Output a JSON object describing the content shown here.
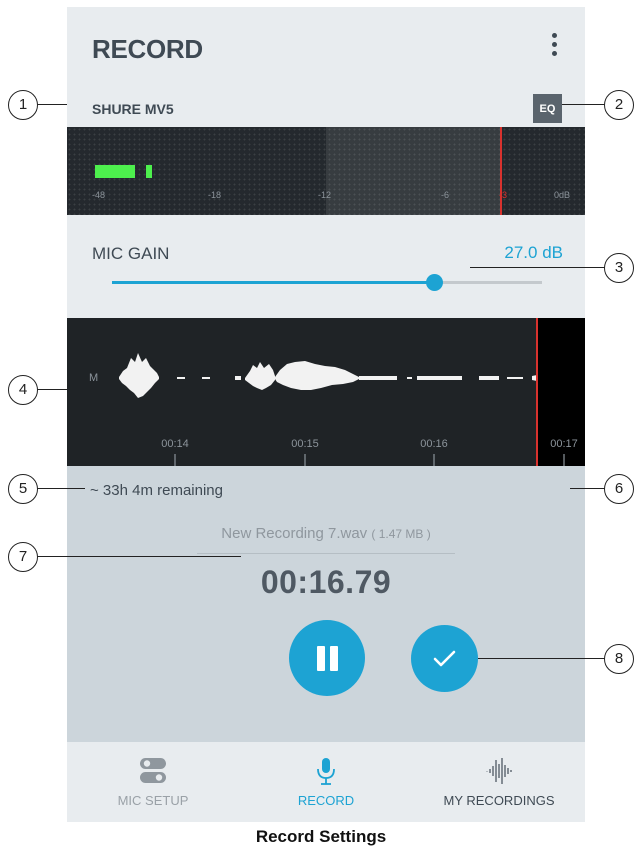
{
  "header": {
    "title": "RECORD",
    "menu_icon": "kebab-menu-icon"
  },
  "device": {
    "name": "SHURE MV5",
    "eq_label": "EQ"
  },
  "level_meter": {
    "ticks": [
      "-48",
      "-18",
      "-12",
      "-6",
      "-3",
      "0dB"
    ],
    "peak_color": "#d9322e",
    "level_color": "#4df04d"
  },
  "mic_gain": {
    "label": "MIC GAIN",
    "value_text": "27.0 dB",
    "slider_fraction": 0.75
  },
  "waveform": {
    "channel_label": "M",
    "time_labels": [
      "00:14",
      "00:15",
      "00:16",
      "00:17"
    ],
    "playhead_color": "#d9322e"
  },
  "storage": {
    "remaining_text": "~ 33h 4m remaining"
  },
  "recording": {
    "file_name": "New Recording 7.wav",
    "file_size": "( 1.47 MB )",
    "elapsed": "00:16.79",
    "pause_icon": "pause-icon",
    "done_icon": "checkmark-icon"
  },
  "nav": [
    {
      "label": "MIC SETUP",
      "icon": "toggle-switches-icon",
      "state": "inactive"
    },
    {
      "label": "RECORD",
      "icon": "microphone-icon",
      "state": "active"
    },
    {
      "label": "MY RECORDINGS",
      "icon": "sound-wave-icon",
      "state": "inactive"
    }
  ],
  "callouts": [
    "1",
    "2",
    "3",
    "4",
    "5",
    "6",
    "7",
    "8"
  ],
  "caption": "Record Settings",
  "colors": {
    "accent": "#1da3d3",
    "text_dark": "#3f4a54",
    "panel_bg": "#ccd5db",
    "screen_bg": "#e8ecef"
  }
}
